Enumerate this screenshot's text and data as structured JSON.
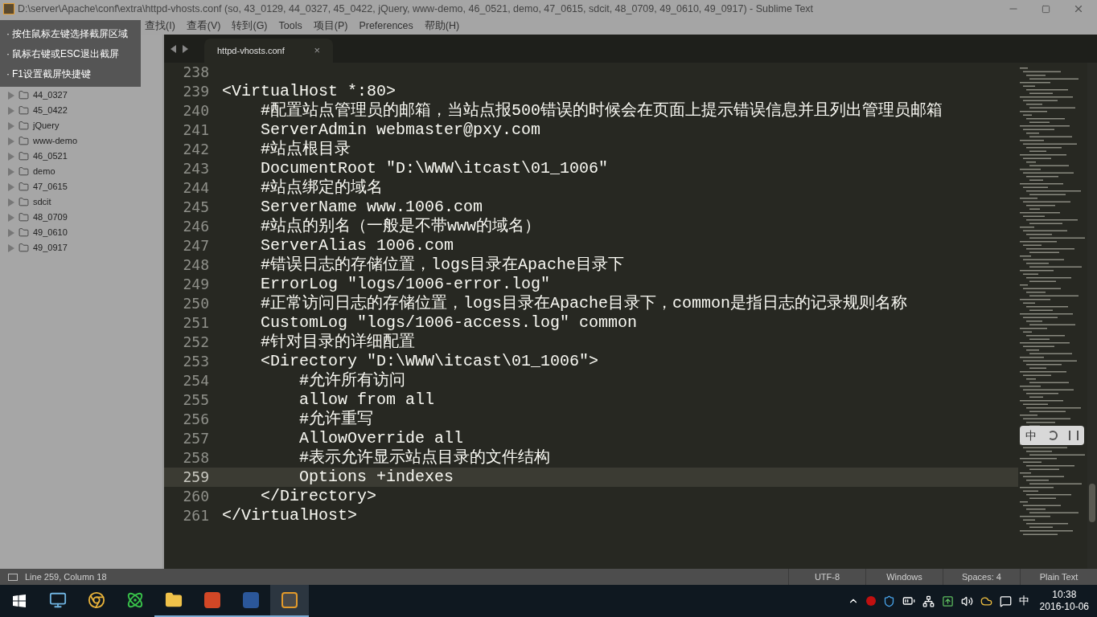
{
  "window": {
    "title": "D:\\server\\Apache\\conf\\extra\\httpd-vhosts.conf (so, 43_0129, 44_0327, 45_0422, jQuery, www-demo, 46_0521, demo, 47_0615, sdcit, 48_0709, 49_0610, 49_0917) - Sublime Text"
  },
  "menu": [
    "查找(I)",
    "查看(V)",
    "转到(G)",
    "Tools",
    "项目(P)",
    "Preferences",
    "帮助(H)"
  ],
  "screenshot_hints": [
    {
      "bullet": "·",
      "text": "按住鼠标左键选择截屏区域"
    },
    {
      "bullet": "·",
      "text": "鼠标右键或ESC退出截屏"
    },
    {
      "bullet": "·",
      "text": "F1设置截屏快捷键"
    }
  ],
  "sidebar": {
    "folders": [
      {
        "name": "44_0327",
        "expanded": false
      },
      {
        "name": "45_0422",
        "expanded": false
      },
      {
        "name": "jQuery",
        "expanded": false
      },
      {
        "name": "www-demo",
        "expanded": false
      },
      {
        "name": "46_0521",
        "expanded": false
      },
      {
        "name": "demo",
        "expanded": false
      },
      {
        "name": "47_0615",
        "expanded": false
      },
      {
        "name": "sdcit",
        "expanded": false
      },
      {
        "name": "48_0709",
        "expanded": false
      },
      {
        "name": "49_0610",
        "expanded": false
      },
      {
        "name": "49_0917",
        "expanded": false
      }
    ]
  },
  "tabs": [
    {
      "label": "httpd-vhosts.conf",
      "selected": true,
      "close": "×"
    }
  ],
  "editor": {
    "lines": [
      {
        "number": "238",
        "current": false
      },
      {
        "number": "239",
        "text": "<VirtualHost *:80>",
        "current": false
      },
      {
        "number": "240",
        "text": "    #配置站点管理员的邮箱，当站点报500错误的时候会在页面上提示错误信息并且列出管理员邮箱",
        "current": false
      },
      {
        "number": "241",
        "text": "    ServerAdmin webmaster@pxy.com",
        "current": false
      },
      {
        "number": "242",
        "text": "    #站点根目录",
        "current": false
      },
      {
        "number": "243",
        "text": "    DocumentRoot \"D:\\WWW\\itcast\\01_1006\"",
        "current": false
      },
      {
        "number": "244",
        "text": "    #站点绑定的域名",
        "current": false
      },
      {
        "number": "245",
        "text": "    ServerName www.1006.com",
        "current": false
      },
      {
        "number": "246",
        "text": "    #站点的别名（一般是不带www的域名）",
        "current": false
      },
      {
        "number": "247",
        "text": "    ServerAlias 1006.com",
        "current": false
      },
      {
        "number": "248",
        "text": "    #错误日志的存储位置，logs目录在Apache目录下",
        "current": false
      },
      {
        "number": "249",
        "text": "    ErrorLog \"logs/1006-error.log\"",
        "current": false
      },
      {
        "number": "250",
        "text": "    #正常访问日志的存储位置，logs目录在Apache目录下，common是指日志的记录规则名称",
        "current": false
      },
      {
        "number": "251",
        "text": "    CustomLog \"logs/1006-access.log\" common",
        "current": false
      },
      {
        "number": "252",
        "text": "    #针对目录的详细配置",
        "current": false
      },
      {
        "number": "253",
        "text": "    <Directory \"D:\\WWW\\itcast\\01_1006\">",
        "current": false
      },
      {
        "number": "254",
        "text": "        #允许所有访问",
        "current": false
      },
      {
        "number": "255",
        "text": "        allow from all",
        "current": false
      },
      {
        "number": "256",
        "text": "        #允许重写",
        "current": false
      },
      {
        "number": "257",
        "text": "        AllowOverride all",
        "current": false
      },
      {
        "number": "258",
        "text": "        #表示允许显示站点目录的文件结构",
        "current": false
      },
      {
        "number": "259",
        "text": "        Options +indexes",
        "current": true
      },
      {
        "number": "260",
        "text": "    </Directory>",
        "current": false
      },
      {
        "number": "261",
        "text": "</VirtualHost>",
        "current": false
      }
    ]
  },
  "ime_toolbar": {
    "mode": "中"
  },
  "status_bar": {
    "position": "Line 259, Column 18",
    "items": [
      "UTF-8",
      "Windows",
      "Spaces: 4",
      "Plain Text"
    ]
  },
  "taskbar": {
    "apps": [
      {
        "kind": "monitor",
        "running": false,
        "selected": false
      },
      {
        "kind": "browser",
        "running": false,
        "selected": false
      },
      {
        "kind": "atom",
        "running": false,
        "selected": false
      },
      {
        "kind": "folder",
        "running": true,
        "selected": false
      },
      {
        "kind": "powerpoint",
        "running": true,
        "selected": false
      },
      {
        "kind": "word",
        "running": true,
        "selected": false
      },
      {
        "kind": "editor",
        "running": true,
        "selected": true
      }
    ],
    "language": "中",
    "time": "10:38",
    "date": "2016-10-06"
  }
}
